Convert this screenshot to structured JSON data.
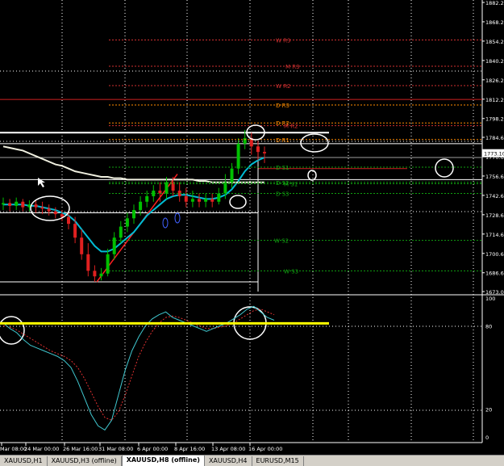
{
  "window": {
    "symbol": "XAUUSD",
    "timeframe": "H8"
  },
  "colors": {
    "background": "#000000",
    "price_line": "#ffffff",
    "ma_fast": "#00bcd4",
    "ma_slow": "#f0f0e0",
    "bull": "#00c000",
    "bear": "#e02020",
    "weekly_pivot": "#d03030",
    "daily_pivot": "#ff8c00",
    "support": "#10a010",
    "stoch_main": "#40c8d0",
    "stoch_signal": "#e03030",
    "level_highlight": "#ffff00"
  },
  "price_axis": {
    "labels": [
      "1882.20",
      "1868.20",
      "1854.20",
      "1840.20",
      "1826.20",
      "1812.20",
      "1798.20",
      "1784.60",
      "1770.60",
      "1756.60",
      "1742.60",
      "1728.60",
      "1714.60",
      "1700.60",
      "1686.60",
      "1673.00"
    ],
    "current_price": "1773.10"
  },
  "pivot_labels": [
    {
      "text": "W R3",
      "color": "#d03030"
    },
    {
      "text": "M R3",
      "color": "#d03030"
    },
    {
      "text": "W R2",
      "color": "#d03030"
    },
    {
      "text": "D R3",
      "color": "#ff8c00"
    },
    {
      "text": "D R2",
      "color": "#ff8c00"
    },
    {
      "text": "M R2",
      "color": "#d03030"
    },
    {
      "text": "D R1",
      "color": "#ff8c00"
    },
    {
      "text": "D S1",
      "color": "#10a010"
    },
    {
      "text": "D S2",
      "color": "#10a010"
    },
    {
      "text": "M S1",
      "color": "#10a010"
    },
    {
      "text": "D S3",
      "color": "#10a010"
    },
    {
      "text": "W S2",
      "color": "#10a010"
    },
    {
      "text": "W S3",
      "color": "#10a010"
    }
  ],
  "oscillator": {
    "axis_labels": [
      "100",
      "80",
      "20",
      "0"
    ],
    "level_80": 80,
    "level_20": 20
  },
  "time_axis": {
    "labels": [
      "Mar 08:00",
      "24 Mar 00:00",
      "26 Mar 16:00",
      "31 Mar 08:00",
      "6 Apr 00:00",
      "8 Apr 16:00",
      "13 Apr 08:00",
      "16 Apr 00:00"
    ]
  },
  "tabs": [
    {
      "label": "XAUUSD,H1",
      "active": false
    },
    {
      "label": "XAUUSD,H3 (offline)",
      "active": false
    },
    {
      "label": "XAUUSD,H8 (offline)",
      "active": true
    },
    {
      "label": "XAUUSD,H4",
      "active": false
    },
    {
      "label": "EURUSD,M15",
      "active": false
    }
  ],
  "chart_data": {
    "type": "candlestick",
    "symbol": "XAUUSD",
    "timeframe": "H8",
    "ylim": [
      1673.0,
      1882.2
    ],
    "x": [
      "Mar 08:00",
      "",
      "",
      "",
      "24 Mar 00:00",
      "",
      "",
      "",
      "",
      "26 Mar 16:00",
      "",
      "",
      "",
      "",
      "",
      "31 Mar 08:00",
      "",
      "",
      "",
      "",
      "",
      "6 Apr 00:00",
      "",
      "",
      "",
      "",
      "8 Apr 16:00",
      "",
      "",
      "",
      "",
      "",
      "13 Apr 08:00",
      "",
      "",
      "",
      "",
      "16 Apr 00:00",
      "",
      "",
      ""
    ],
    "open": [
      1736,
      1737,
      1735,
      1738,
      1734,
      1736,
      1734,
      1733,
      1731,
      1729,
      1727,
      1722,
      1712,
      1700,
      1688,
      1684,
      1686,
      1700,
      1712,
      1720,
      1726,
      1732,
      1738,
      1742,
      1746,
      1744,
      1752,
      1746,
      1742,
      1738,
      1740,
      1738,
      1740,
      1738,
      1744,
      1752,
      1762,
      1780,
      1784,
      1778,
      1774
    ],
    "close": [
      1737,
      1735,
      1738,
      1734,
      1736,
      1734,
      1733,
      1731,
      1729,
      1727,
      1722,
      1712,
      1700,
      1688,
      1684,
      1686,
      1700,
      1712,
      1720,
      1726,
      1732,
      1738,
      1742,
      1746,
      1744,
      1752,
      1746,
      1742,
      1738,
      1740,
      1738,
      1740,
      1738,
      1744,
      1752,
      1762,
      1780,
      1784,
      1778,
      1774,
      1773
    ],
    "high": [
      1741,
      1740,
      1741,
      1740,
      1739,
      1739,
      1738,
      1736,
      1734,
      1732,
      1730,
      1727,
      1718,
      1708,
      1692,
      1690,
      1704,
      1716,
      1724,
      1730,
      1736,
      1742,
      1746,
      1750,
      1752,
      1756,
      1756,
      1752,
      1748,
      1746,
      1744,
      1744,
      1744,
      1748,
      1758,
      1766,
      1784,
      1790,
      1788,
      1782,
      1778
    ],
    "low": [
      1732,
      1731,
      1732,
      1731,
      1731,
      1730,
      1729,
      1728,
      1726,
      1724,
      1718,
      1708,
      1696,
      1684,
      1680,
      1681,
      1684,
      1696,
      1708,
      1716,
      1722,
      1728,
      1734,
      1738,
      1738,
      1740,
      1742,
      1738,
      1734,
      1734,
      1734,
      1734,
      1734,
      1736,
      1740,
      1748,
      1758,
      1776,
      1772,
      1768,
      1766
    ],
    "series": [
      {
        "name": "",
        "kind": "ma_fast",
        "values": [
          1736,
          1736,
          1736,
          1736,
          1735,
          1735,
          1734,
          1733,
          1732,
          1730,
          1728,
          1724,
          1718,
          1712,
          1706,
          1702,
          1702,
          1704,
          1708,
          1712,
          1716,
          1722,
          1728,
          1732,
          1736,
          1740,
          1742,
          1743,
          1743,
          1742,
          1741,
          1740,
          1740,
          1741,
          1743,
          1747,
          1753,
          1760,
          1765,
          1768,
          1770
        ]
      },
      {
        "name": "",
        "kind": "ma_slow",
        "values": [
          1778,
          1777,
          1776,
          1775,
          1773,
          1771,
          1769,
          1767,
          1765,
          1764,
          1762,
          1760,
          1759,
          1758,
          1757,
          1756,
          1756,
          1755,
          1755,
          1754,
          1754,
          1754,
          1754,
          1754,
          1754,
          1754,
          1754,
          1754,
          1754,
          1754,
          1753,
          1753,
          1752,
          1752,
          1752,
          1752,
          1752,
          1752,
          1752,
          1752,
          1752
        ]
      }
    ],
    "stochastic": {
      "main": [
        82,
        78,
        75,
        70,
        66,
        64,
        62,
        60,
        58,
        55,
        50,
        40,
        28,
        16,
        8,
        5,
        12,
        30,
        48,
        62,
        72,
        80,
        85,
        88,
        90,
        86,
        84,
        82,
        80,
        78,
        76,
        78,
        80,
        82,
        85,
        88,
        92,
        94,
        90,
        86,
        84
      ],
      "signal": [
        80,
        79,
        77,
        74,
        71,
        68,
        65,
        62,
        60,
        58,
        55,
        50,
        42,
        32,
        22,
        14,
        12,
        18,
        30,
        44,
        58,
        68,
        76,
        82,
        86,
        87,
        86,
        84,
        82,
        80,
        78,
        78,
        79,
        80,
        82,
        85,
        88,
        91,
        92,
        90,
        88
      ]
    }
  }
}
